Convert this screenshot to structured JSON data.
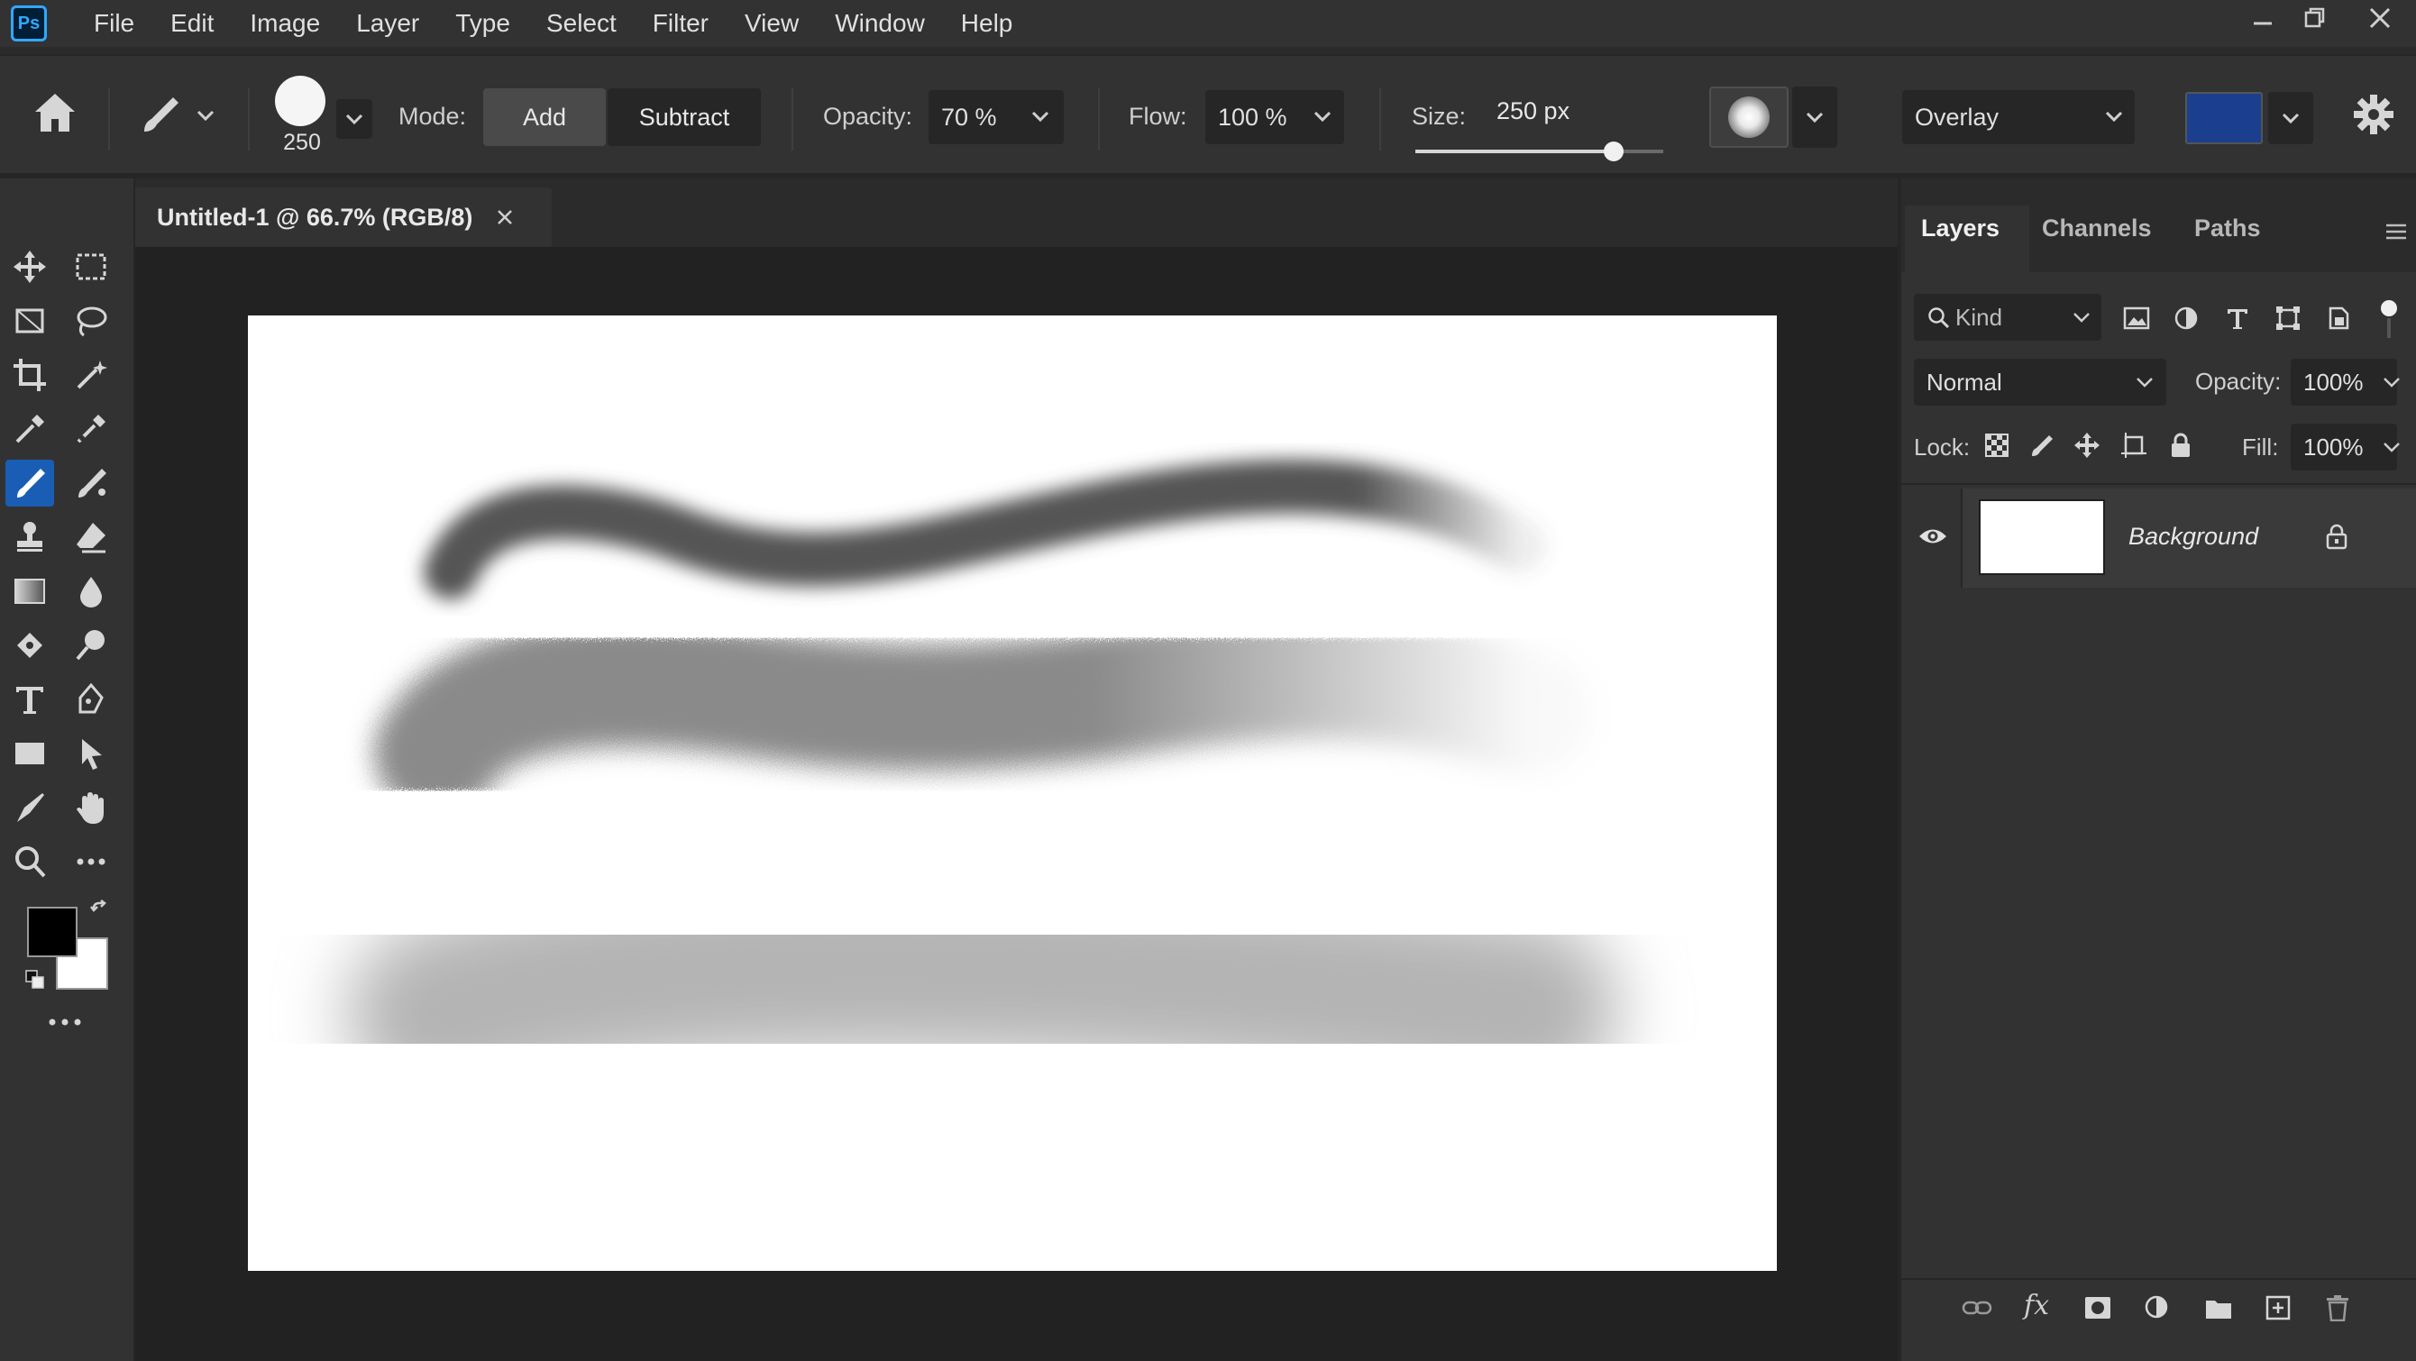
{
  "app": {
    "logo_text": "Ps",
    "menu": [
      "File",
      "Edit",
      "Image",
      "Layer",
      "Type",
      "Select",
      "Filter",
      "View",
      "Window",
      "Help"
    ]
  },
  "options": {
    "brush_size_preview": "250",
    "mode_label": "Mode:",
    "mode_add": "Add",
    "mode_subtract": "Subtract",
    "opacity_label": "Opacity:",
    "opacity_value": "70 %",
    "flow_label": "Flow:",
    "flow_value": "100 %",
    "size_label": "Size:",
    "size_value": "250 px",
    "size_slider_fraction": 0.8,
    "blend_mode": "Overlay",
    "color_swatch": "#1b3e8f"
  },
  "document": {
    "tab_title": "Untitled-1 @ 66.7% (RGB/8)"
  },
  "tools": {
    "foreground_color": "#000000",
    "background_color": "#ffffff"
  },
  "layers_panel": {
    "tabs": [
      "Layers",
      "Channels",
      "Paths"
    ],
    "filter_kind": "Kind",
    "blend_mode": "Normal",
    "opacity_label": "Opacity:",
    "opacity_value": "100%",
    "lock_label": "Lock:",
    "fill_label": "Fill:",
    "fill_value": "100%",
    "layers": [
      {
        "name": "Background",
        "visible": true,
        "locked": true
      }
    ]
  },
  "colors": {
    "accent_active_tool": "#1a5db4",
    "panel_bg": "#323232",
    "workspace_bg": "#222222"
  }
}
